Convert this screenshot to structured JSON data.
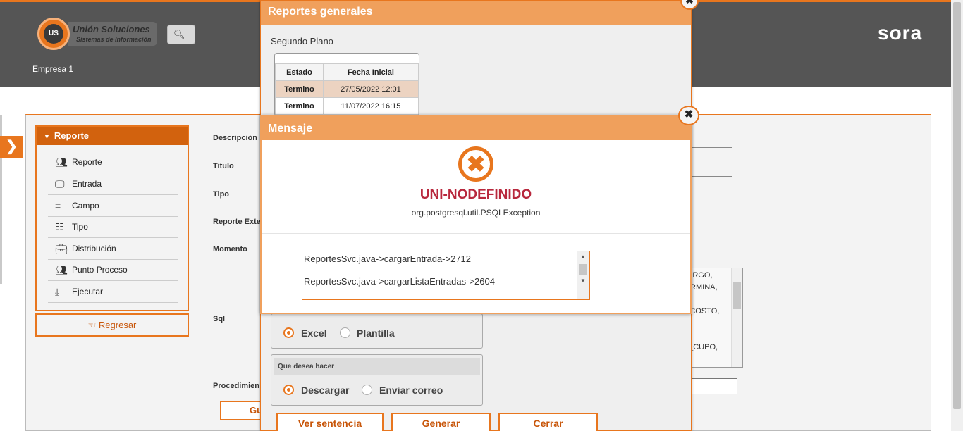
{
  "header": {
    "logo_title": "Unión Soluciones",
    "logo_subtitle": "Sistemas de Información",
    "logo_mark": "US",
    "brand": "sora",
    "company": "Empresa 1",
    "search_icon": "search-icon"
  },
  "sidebar": {
    "title": "Reporte",
    "items": [
      {
        "label": "Reporte",
        "icon": "users-icon"
      },
      {
        "label": "Entrada",
        "icon": "monitor-icon"
      },
      {
        "label": "Campo",
        "icon": "database-icon"
      },
      {
        "label": "Tipo",
        "icon": "list-icon"
      },
      {
        "label": "Distribución",
        "icon": "briefcase-icon"
      },
      {
        "label": "Punto Proceso",
        "icon": "users-icon"
      },
      {
        "label": "Ejecutar",
        "icon": "download-icon"
      }
    ],
    "back_label": "Regresar"
  },
  "form": {
    "labels": {
      "descripcion": "Descripción",
      "titulo": "Titulo",
      "tipo": "Tipo",
      "reporte_externo": "Reporte Exte",
      "momento": "Momento",
      "sql": "Sql",
      "procedimiento": "Procedimien"
    },
    "sql_lines": [
      "ARGO,",
      "TERMINA,",
      "ACOSTO,",
      "L_CUPO,"
    ],
    "save_label": "Gu"
  },
  "dialog_reportes": {
    "title": "Reportes generales",
    "section": "Segundo Plano",
    "table": {
      "headers": [
        "Estado",
        "Fecha Inicial"
      ],
      "rows": [
        {
          "estado": "Termino",
          "fecha": "27/05/2022 12:01"
        },
        {
          "estado": "Termino",
          "fecha": "11/07/2022 16:15"
        }
      ]
    },
    "tipo_options": {
      "excel": "Excel",
      "plantilla": "Plantilla",
      "selected": "Excel"
    },
    "accion": {
      "heading": "Que desea hacer",
      "descargar": "Descargar",
      "enviar": "Enviar correo",
      "selected": "Descargar"
    },
    "buttons": {
      "ver": "Ver sentencia",
      "generar": "Generar",
      "cerrar": "Cerrar"
    }
  },
  "dialog_mensaje": {
    "title": "Mensaje",
    "error_code": "UNI-NODEFINIDO",
    "exception": "org.postgresql.util.PSQLException",
    "trace": [
      "ReportesSvc.java->cargarEntrada->2712",
      "ReportesSvc.java->cargarListaEntradas->2604"
    ]
  },
  "colors": {
    "accent": "#e8761e",
    "header": "#555555",
    "error": "#b8283d"
  }
}
